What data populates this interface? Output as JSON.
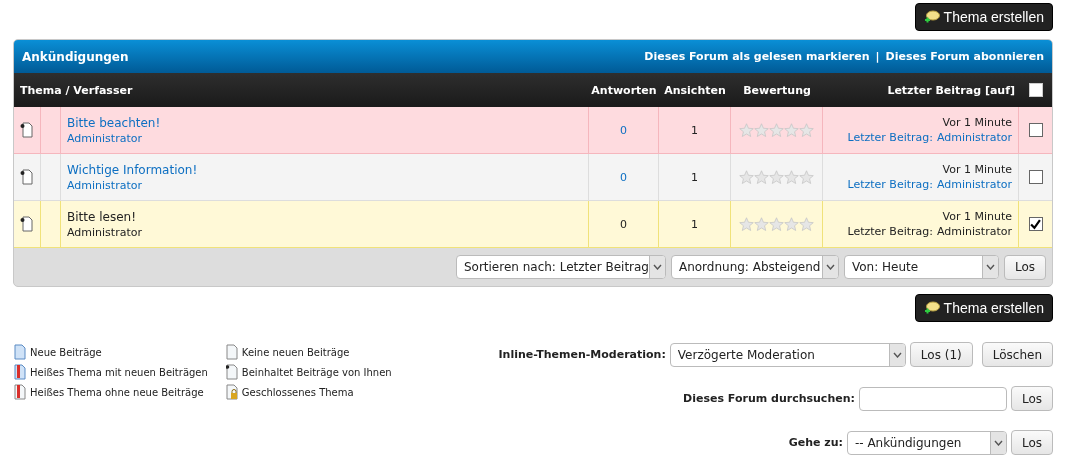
{
  "new_topic_button": "Thema erstellen",
  "forum": {
    "title": "Ankündigungen",
    "actions": [
      "Dieses Forum als gelesen markieren",
      "Dieses Forum abonnieren"
    ],
    "separator": "|",
    "columns": [
      "Thema / Verfasser",
      "Antworten",
      "Ansichten",
      "Bewertung",
      "Letzter Beitrag [auf]"
    ],
    "select_all": {
      "checked": false
    },
    "rows": [
      {
        "kind": "moderated",
        "title": "Bitte beachten!",
        "author": "Administrator",
        "replies": "0",
        "views": "1",
        "stars": 0,
        "time": "Vor 1 Minute",
        "last_label": "Letzter Beitrag",
        "colon": ":",
        "last_author": "Administrator",
        "checked": false
      },
      {
        "kind": "normal",
        "title": "Wichtige Information!",
        "author": "Administrator",
        "replies": "0",
        "views": "1",
        "stars": 0,
        "time": "Vor 1 Minute",
        "last_label": "Letzter Beitrag",
        "colon": ":",
        "last_author": "Administrator",
        "checked": false
      },
      {
        "kind": "normal",
        "title": "Bitte lesen!",
        "author": "Administrator",
        "replies": "0",
        "views": "1",
        "stars": 0,
        "time": "Vor 1 Minute",
        "last_label": "Letzter Beitrag",
        "colon": ":",
        "last_author": "Administrator",
        "checked": true
      }
    ],
    "sort_controls": [
      {
        "kind": "sort",
        "value": "Sortieren nach: Letzter Beitrag"
      },
      {
        "kind": "order",
        "value": "Anordnung: Absteigend"
      },
      {
        "kind": "from",
        "value": "Von: Heute"
      }
    ],
    "sort_button": "Los"
  },
  "bottom_button": "Thema erstellen",
  "legend": [
    {
      "kind": "new",
      "label": "Neue Beiträge"
    },
    {
      "kind": "hot_new",
      "label": "Heißes Thema mit neuen Beiträgen"
    },
    {
      "kind": "hot",
      "label": "Heißes Thema ohne neue Beiträge"
    },
    {
      "kind": "none",
      "label": "Keine neuen Beiträge"
    },
    {
      "kind": "own",
      "label": "Beinhaltet Beiträge von Ihnen"
    },
    {
      "kind": "locked",
      "label": "Geschlossenes Thema"
    }
  ],
  "moderation": {
    "label": "Inline-Themen-Moderation:",
    "value": "Verzögerte Moderation",
    "go": "Los (1)",
    "clear": "Löschen"
  },
  "search": {
    "label": "Dieses Forum durchsuchen:",
    "go": "Los"
  },
  "goto": {
    "label": "Gehe zu:",
    "value": "-- Ankündigungen",
    "go": "Los"
  }
}
